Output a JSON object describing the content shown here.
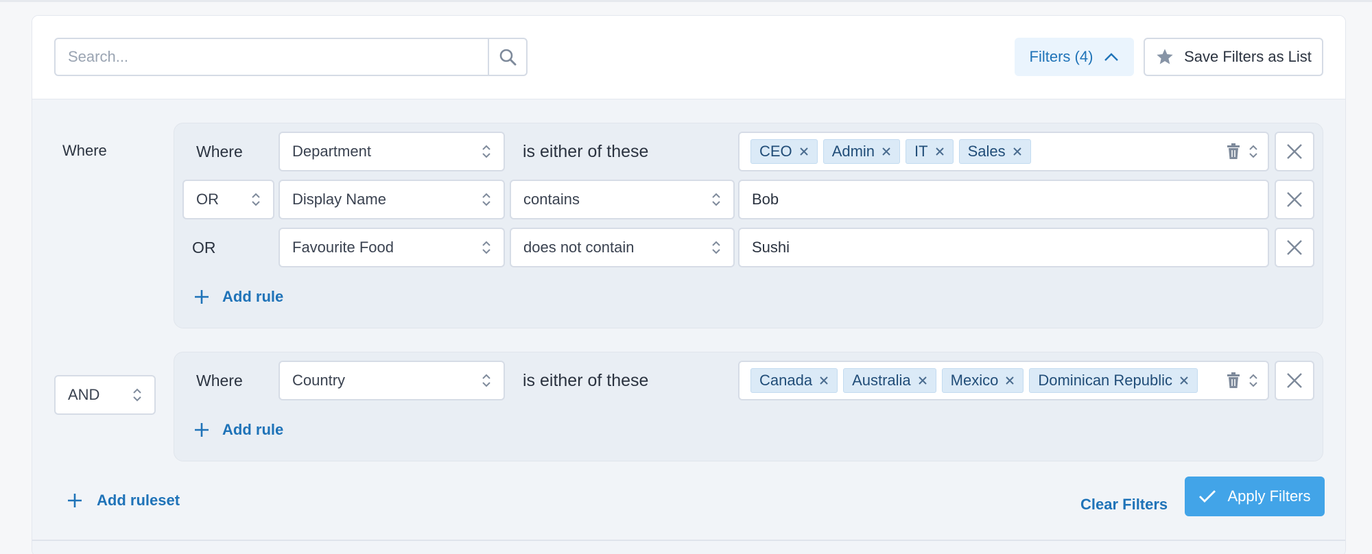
{
  "search": {
    "placeholder": "Search...",
    "value": ""
  },
  "toolbar": {
    "filters_label": "Filters (4)",
    "save_label": "Save Filters as List"
  },
  "where_label": "Where",
  "rulesets": [
    {
      "rules": [
        {
          "conjunction": "Where",
          "field": "Department",
          "operator": "is either of these",
          "tags": [
            "CEO",
            "Admin",
            "IT",
            "Sales"
          ]
        },
        {
          "conjunction": "OR",
          "field": "Display Name",
          "operator": "contains",
          "value": "Bob"
        },
        {
          "conjunction": "OR",
          "field": "Favourite Food",
          "operator": "does not contain",
          "value": "Sushi"
        }
      ],
      "add_rule_label": "Add rule"
    },
    {
      "conjunction": "AND",
      "rules": [
        {
          "conjunction": "Where",
          "field": "Country",
          "operator": "is either of these",
          "tags": [
            "Canada",
            "Australia",
            "Mexico",
            "Dominican Republic"
          ]
        }
      ],
      "add_rule_label": "Add rule"
    }
  ],
  "footer": {
    "add_ruleset_label": "Add ruleset",
    "clear_label": "Clear Filters",
    "apply_label": "Apply Filters"
  },
  "colors": {
    "accent": "#1f73b8",
    "apply_button": "#42a4e8",
    "tag_background": "#dbeaf7",
    "ruleset_background": "#e9eef4"
  },
  "icons": [
    "search-icon",
    "chevron-up-icon",
    "star-icon",
    "chevron-updown-icon",
    "close-icon",
    "trash-icon",
    "plus-icon",
    "check-icon"
  ]
}
